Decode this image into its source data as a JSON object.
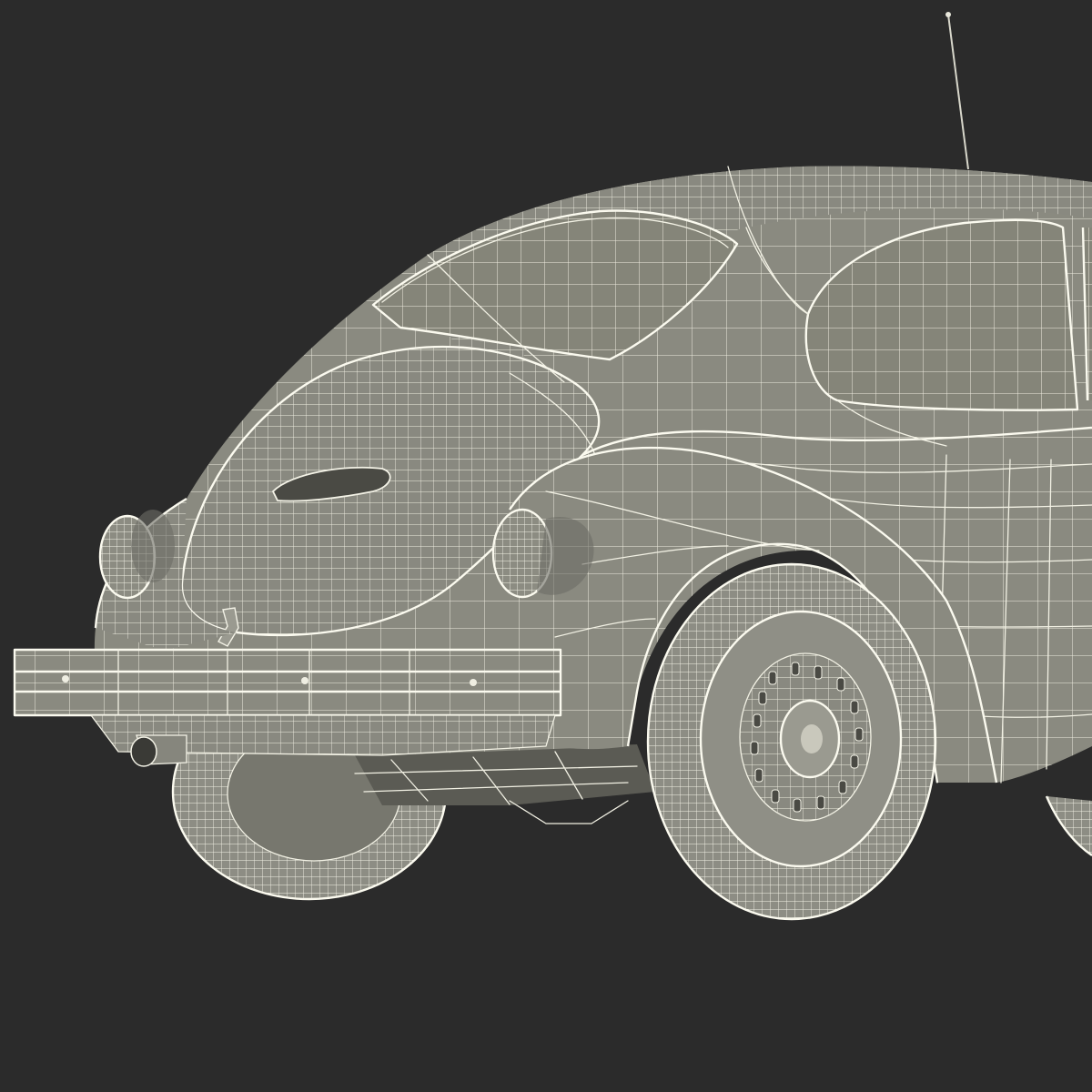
{
  "scene": {
    "background": "#2b2b2b",
    "subject": "car-wireframe-3d-model",
    "colors": {
      "body": "#8a8a80",
      "body_shadow": "#6f6f66",
      "wireframe": "#f2f1e4",
      "tire": "#8d8d84"
    }
  }
}
